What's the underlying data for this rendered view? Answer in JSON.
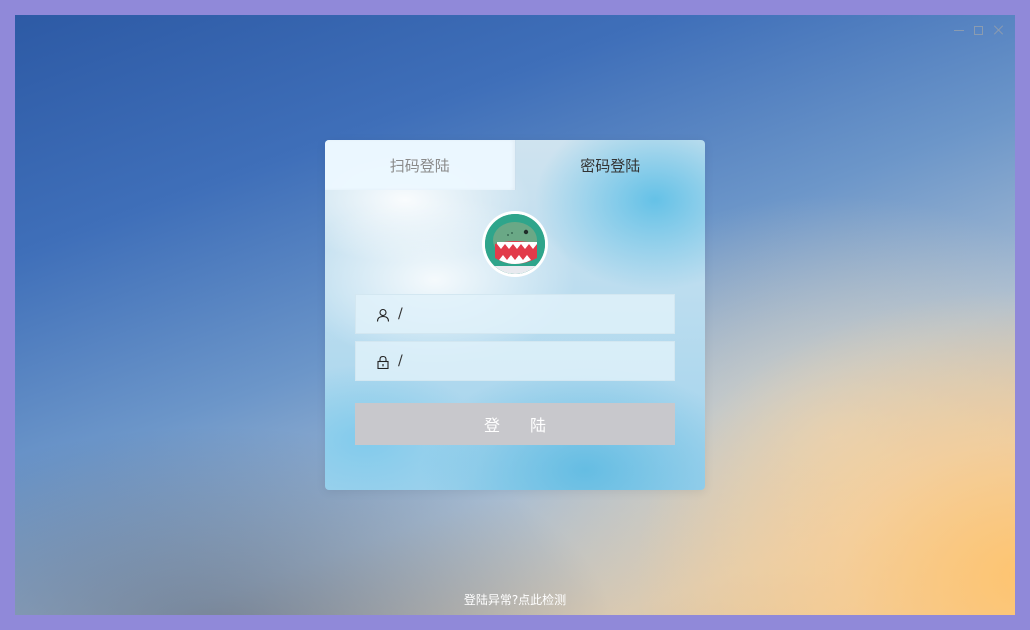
{
  "tabs": [
    {
      "label": "扫码登陆",
      "active": false
    },
    {
      "label": "密码登陆",
      "active": true
    }
  ],
  "form": {
    "username": {
      "separator": "/",
      "value": "",
      "icon": "user-icon"
    },
    "password": {
      "separator": "/",
      "value": "",
      "icon": "lock-icon"
    },
    "submit_label": "登陆"
  },
  "footer": {
    "link": "登陆异常?点此检测"
  },
  "colors": {
    "background_outer": "#9089d9",
    "button_bg": "#c8c8cc",
    "avatar_bg": "#2fa58b"
  }
}
